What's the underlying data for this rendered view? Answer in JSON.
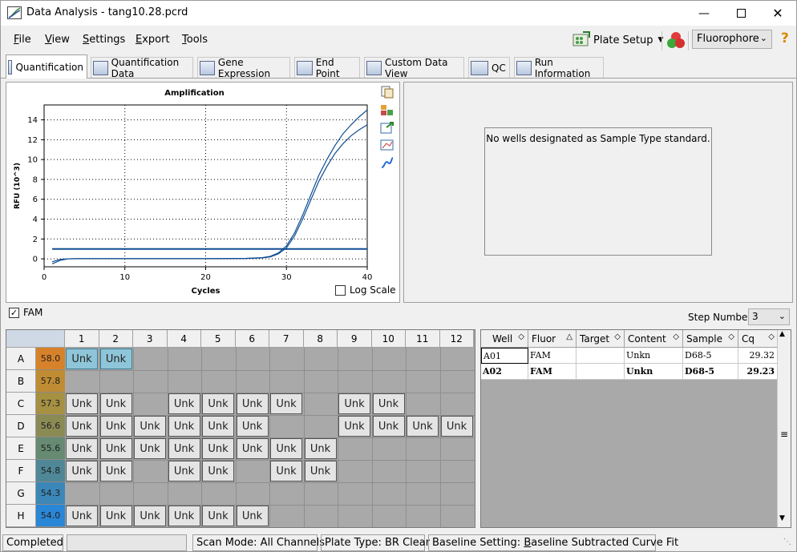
{
  "window": {
    "title": "Data Analysis - tang10.28.pcrd"
  },
  "menu": [
    {
      "label": "File",
      "key": "F"
    },
    {
      "label": "View",
      "key": "V"
    },
    {
      "label": "Settings",
      "key": "S"
    },
    {
      "label": "Export",
      "key": "E"
    },
    {
      "label": "Tools",
      "key": "T"
    }
  ],
  "toolbar": {
    "plate_setup": "Plate Setup",
    "fluorophore": "Fluorophore",
    "help": "?"
  },
  "tabs": [
    {
      "label": "Quantification",
      "active": true
    },
    {
      "label": "Quantification Data"
    },
    {
      "label": "Gene Expression"
    },
    {
      "label": "End Point"
    },
    {
      "label": "Custom Data View"
    },
    {
      "label": "QC"
    },
    {
      "label": "Run Information"
    }
  ],
  "chart_data": {
    "type": "line",
    "title": "Amplification",
    "xlabel": "Cycles",
    "ylabel": "RFU (10^3)",
    "xlim": [
      0,
      40
    ],
    "ylim": [
      -0.8,
      15.5
    ],
    "xticks": [
      0,
      10,
      20,
      30,
      40
    ],
    "yticks": [
      0,
      2,
      4,
      6,
      8,
      10,
      12,
      14
    ],
    "grid": true,
    "threshold": 1.0,
    "series": [
      {
        "x": [
          1,
          2,
          3,
          4,
          5,
          10,
          15,
          20,
          25,
          27,
          28,
          29,
          30,
          31,
          32,
          33,
          34,
          35,
          36,
          37,
          38,
          39,
          40
        ],
        "y": [
          -0.5,
          -0.15,
          0.0,
          0.02,
          0.02,
          0.02,
          0.02,
          0.02,
          0.05,
          0.12,
          0.25,
          0.6,
          1.3,
          2.6,
          4.4,
          6.4,
          8.4,
          10.0,
          11.4,
          12.6,
          13.5,
          14.3,
          15.0
        ],
        "color": "#0f4d92"
      },
      {
        "x": [
          1,
          2,
          3,
          4,
          5,
          10,
          15,
          20,
          25,
          27,
          28,
          29,
          30,
          31,
          32,
          33,
          34,
          35,
          36,
          37,
          38,
          39,
          40
        ],
        "y": [
          -0.3,
          -0.05,
          0.0,
          0.02,
          0.02,
          0.02,
          0.02,
          0.02,
          0.04,
          0.1,
          0.2,
          0.5,
          1.1,
          2.3,
          4.0,
          5.9,
          7.8,
          9.3,
          10.6,
          11.6,
          12.4,
          13.0,
          13.5
        ],
        "color": "#0f4d92"
      }
    ]
  },
  "log_scale": {
    "label": "Log Scale",
    "checked": false
  },
  "standard_msg": "No wells designated as Sample Type standard.",
  "fluor_check": {
    "label": "FAM",
    "checked": true
  },
  "step": {
    "label": "Step Number:",
    "value": "3"
  },
  "plate": {
    "columns": [
      "1",
      "2",
      "3",
      "4",
      "5",
      "6",
      "7",
      "8",
      "9",
      "10",
      "11",
      "12"
    ],
    "rows": [
      {
        "label": "A",
        "temp": "58.0",
        "color": "#d7822a",
        "wells": [
          "Unk",
          "Unk",
          "",
          "",
          "",
          "",
          "",
          "",
          "",
          "",
          "",
          ""
        ],
        "selected": [
          0,
          1
        ]
      },
      {
        "label": "B",
        "temp": "57.8",
        "color": "#c08c33",
        "wells": [
          "",
          "",
          "",
          "",
          "",
          "",
          "",
          "",
          "",
          "",
          "",
          ""
        ]
      },
      {
        "label": "C",
        "temp": "57.3",
        "color": "#a69042",
        "wells": [
          "Unk",
          "Unk",
          "",
          "Unk",
          "Unk",
          "Unk",
          "Unk",
          "",
          "Unk",
          "Unk",
          "",
          ""
        ]
      },
      {
        "label": "D",
        "temp": "56.6",
        "color": "#8a8a55",
        "wells": [
          "Unk",
          "Unk",
          "Unk",
          "Unk",
          "Unk",
          "Unk",
          "",
          "",
          "Unk",
          "Unk",
          "Unk",
          "Unk"
        ]
      },
      {
        "label": "E",
        "temp": "55.6",
        "color": "#668a72",
        "wells": [
          "Unk",
          "Unk",
          "Unk",
          "Unk",
          "Unk",
          "Unk",
          "Unk",
          "Unk",
          "",
          "",
          "",
          ""
        ]
      },
      {
        "label": "F",
        "temp": "54.8",
        "color": "#4f8796",
        "wells": [
          "Unk",
          "Unk",
          "",
          "Unk",
          "Unk",
          "",
          "Unk",
          "Unk",
          "",
          "",
          "",
          ""
        ]
      },
      {
        "label": "G",
        "temp": "54.3",
        "color": "#3b87b8",
        "wells": [
          "",
          "",
          "",
          "",
          "",
          "",
          "",
          "",
          "",
          "",
          "",
          ""
        ]
      },
      {
        "label": "H",
        "temp": "54.0",
        "color": "#2a86d6",
        "wells": [
          "Unk",
          "Unk",
          "Unk",
          "Unk",
          "Unk",
          "Unk",
          "",
          "",
          "",
          "",
          "",
          ""
        ]
      }
    ]
  },
  "well_table": {
    "headers": [
      "Well",
      "Fluor",
      "Target",
      "Content",
      "Sample",
      "Cq"
    ],
    "rows": [
      {
        "well": "A01",
        "fluor": "FAM",
        "target": "",
        "content": "Unkn",
        "sample": "D68-5",
        "cq": "29.32"
      },
      {
        "well": "A02",
        "fluor": "FAM",
        "target": "",
        "content": "Unkn",
        "sample": "D68-5",
        "cq": "29.23"
      }
    ]
  },
  "status": {
    "state": "Completed",
    "scan_mode": "Scan Mode: All Channels",
    "plate_type": "Plate Type: BR Clear",
    "baseline": "Baseline Setting: Baseline Subtracted Curve Fit"
  }
}
